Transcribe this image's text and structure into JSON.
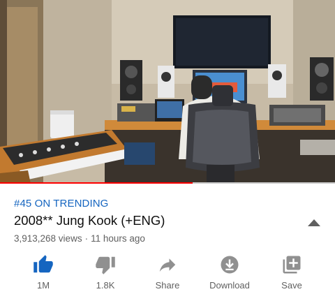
{
  "video": {
    "progress_fraction": 0.575
  },
  "info": {
    "trending_badge": "#45 ON TRENDING",
    "title": "2008** Jung Kook (+ENG)",
    "views": "3,913,268 views",
    "age": "11 hours ago",
    "separator": "·"
  },
  "actions": {
    "like": {
      "label": "1M",
      "icon": "thumb-up-icon"
    },
    "dislike": {
      "label": "1.8K",
      "icon": "thumb-down-icon"
    },
    "share": {
      "label": "Share",
      "icon": "share-icon"
    },
    "download": {
      "label": "Download",
      "icon": "download-icon"
    },
    "save": {
      "label": "Save",
      "icon": "playlist-add-icon"
    }
  },
  "colors": {
    "trending": "#1565c0",
    "like_active": "#1565c0",
    "icon_gray": "#909090",
    "progress": "#ff0000"
  }
}
